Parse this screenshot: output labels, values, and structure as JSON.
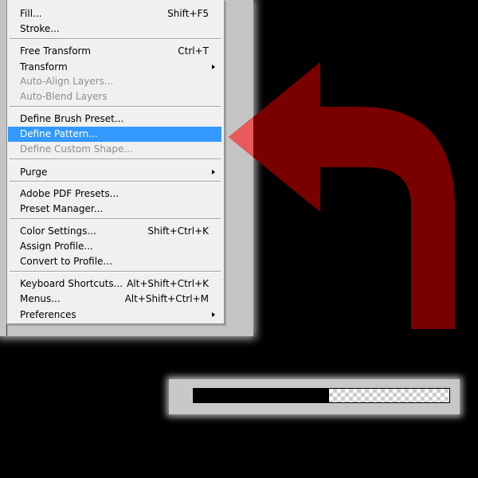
{
  "menu": {
    "items": [
      {
        "label": "Fill...",
        "shortcut": "Shift+F5",
        "disabled": false,
        "highlighted": false,
        "submenu": false
      },
      {
        "label": "Stroke...",
        "shortcut": "",
        "disabled": false,
        "highlighted": false,
        "submenu": false
      },
      {
        "label": "Free Transform",
        "shortcut": "Ctrl+T",
        "disabled": false,
        "highlighted": false,
        "submenu": false
      },
      {
        "label": "Transform",
        "shortcut": "",
        "disabled": false,
        "highlighted": false,
        "submenu": true
      },
      {
        "label": "Auto-Align Layers...",
        "shortcut": "",
        "disabled": true,
        "highlighted": false,
        "submenu": false
      },
      {
        "label": "Auto-Blend Layers",
        "shortcut": "",
        "disabled": true,
        "highlighted": false,
        "submenu": false
      },
      {
        "label": "Define Brush Preset...",
        "shortcut": "",
        "disabled": false,
        "highlighted": false,
        "submenu": false
      },
      {
        "label": "Define Pattern...",
        "shortcut": "",
        "disabled": false,
        "highlighted": true,
        "submenu": false
      },
      {
        "label": "Define Custom Shape...",
        "shortcut": "",
        "disabled": true,
        "highlighted": false,
        "submenu": false
      },
      {
        "label": "Purge",
        "shortcut": "",
        "disabled": false,
        "highlighted": false,
        "submenu": true
      },
      {
        "label": "Adobe PDF Presets...",
        "shortcut": "",
        "disabled": false,
        "highlighted": false,
        "submenu": false
      },
      {
        "label": "Preset Manager...",
        "shortcut": "",
        "disabled": false,
        "highlighted": false,
        "submenu": false
      },
      {
        "label": "Color Settings...",
        "shortcut": "Shift+Ctrl+K",
        "disabled": false,
        "highlighted": false,
        "submenu": false
      },
      {
        "label": "Assign Profile...",
        "shortcut": "",
        "disabled": false,
        "highlighted": false,
        "submenu": false
      },
      {
        "label": "Convert to Profile...",
        "shortcut": "",
        "disabled": false,
        "highlighted": false,
        "submenu": false
      },
      {
        "label": "Keyboard Shortcuts...",
        "shortcut": "Alt+Shift+Ctrl+K",
        "disabled": false,
        "highlighted": false,
        "submenu": false
      },
      {
        "label": "Menus...",
        "shortcut": "Alt+Shift+Ctrl+M",
        "disabled": false,
        "highlighted": false,
        "submenu": false
      },
      {
        "label": "Preferences",
        "shortcut": "",
        "disabled": false,
        "highlighted": false,
        "submenu": true
      }
    ]
  },
  "pointer_arrow": {
    "icon": "curved-arrow-icon",
    "color": "#7a0000",
    "tip_color": "#e85a5a"
  },
  "progress": {
    "fraction": 0.53,
    "fill_color": "#000000",
    "empty_pattern": "transparency-checkerboard"
  },
  "colors": {
    "highlight": "#3399ff",
    "menu_background": "#f0f0f0",
    "disabled_text": "#8d8d8d"
  }
}
